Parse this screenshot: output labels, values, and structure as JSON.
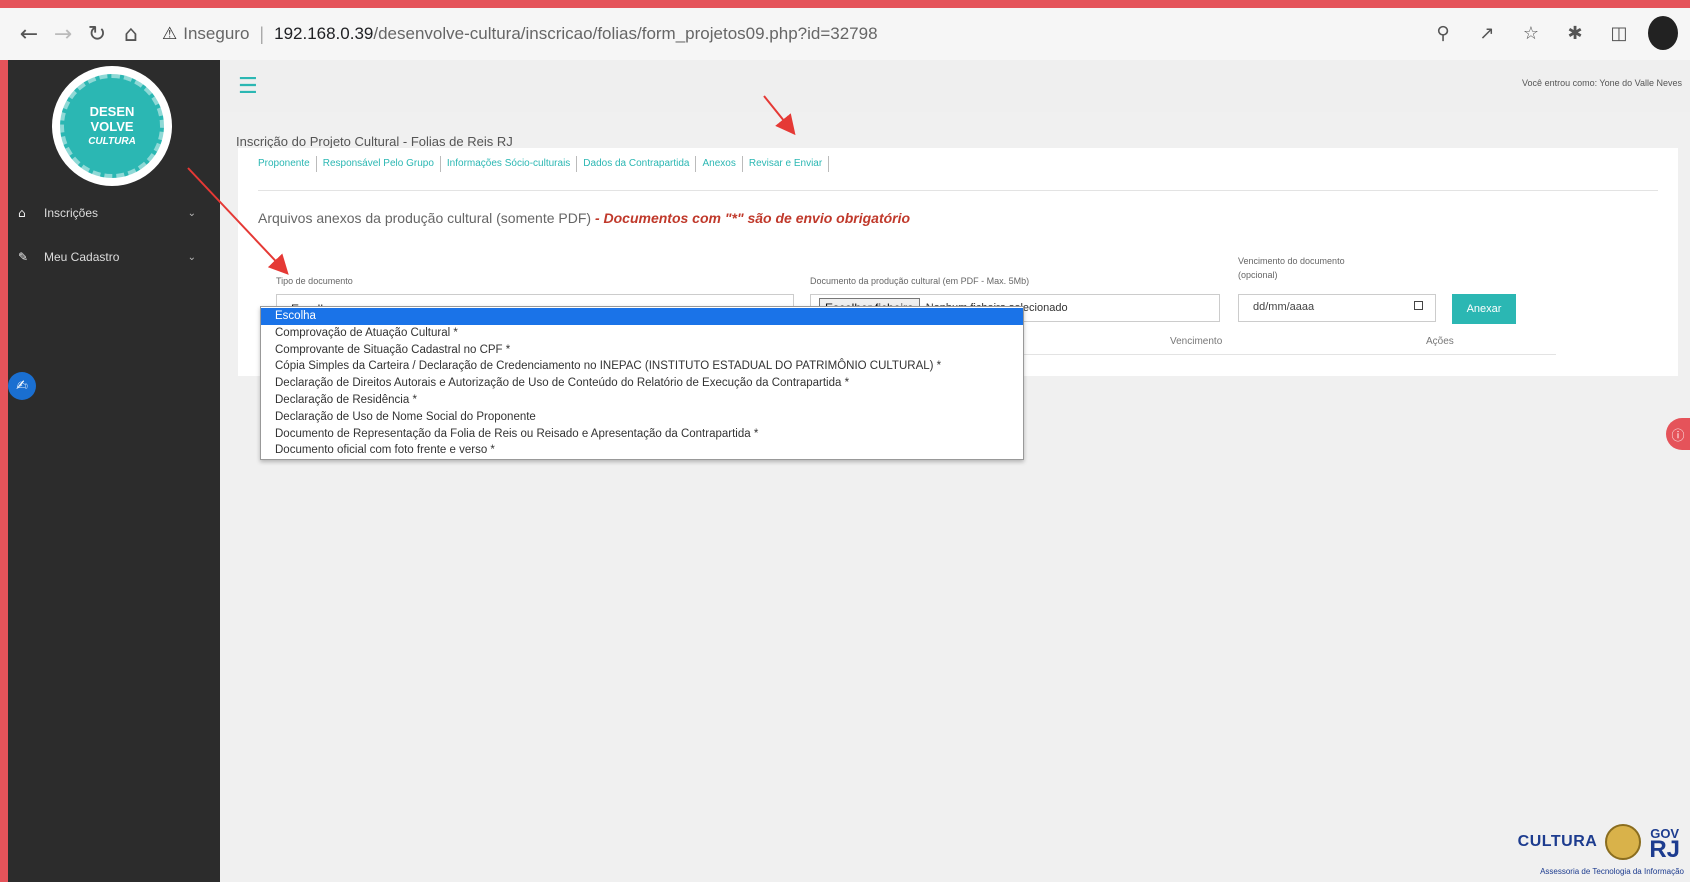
{
  "browser": {
    "insecure_label": "Inseguro",
    "url_host": "192.168.0.39",
    "url_path": "/desenvolve-cultura/inscricao/folias/form_projetos09.php?id=32798"
  },
  "sidebar": {
    "logo_line1": "DESEN",
    "logo_line2": "VOLVE",
    "logo_line3": "CULTURA",
    "items": [
      {
        "label": "Inscrições"
      },
      {
        "label": "Meu Cadastro"
      }
    ]
  },
  "header": {
    "user_info": "Você entrou como: Yone do Valle Neves"
  },
  "page": {
    "title": "Inscrição do Projeto Cultural - Folias de Reis RJ",
    "tabs": [
      {
        "label": "Proponente"
      },
      {
        "label": "Responsável Pelo Grupo"
      },
      {
        "label": "Informações Sócio-culturais"
      },
      {
        "label": "Dados da Contrapartida"
      },
      {
        "label": "Anexos"
      },
      {
        "label": "Revisar e Enviar"
      }
    ],
    "section_heading": "Arquivos anexos da produção cultural (somente PDF)",
    "section_required": " - Documentos com \"*\" são de envio obrigatório"
  },
  "form": {
    "doc_type_label": "Tipo de documento",
    "doc_type_value": "Escolha",
    "file_label": "Documento da produção cultural (em PDF - Max. 5Mb)",
    "file_button": "Escolher ficheiro",
    "file_status": "Nenhum ficheiro selecionado",
    "due_label_1": "Vencimento do documento",
    "due_label_2": "(opcional)",
    "date_placeholder": "dd/mm/aaaa",
    "attach_button": "Anexar",
    "col_vencimento": "Vencimento",
    "col_acoes": "Ações"
  },
  "dropdown": {
    "options": [
      "Escolha",
      "Comprovação de Atuação Cultural *",
      "Comprovante de Situação Cadastral no CPF *",
      "Cópia Simples da Carteira / Declaração de Credenciamento no INEPAC (INSTITUTO ESTADUAL DO PATRIMÔNIO CULTURAL) *",
      "Declaração de Direitos Autorais e Autorização de Uso de Conteúdo do Relatório de Execução da Contrapartida *",
      "Declaração de Residência *",
      "Declaração de Uso de Nome Social do Proponente",
      "Documento de Representação da Folia de Reis ou Reisado e Apresentação da Contrapartida *",
      "Documento oficial com foto frente e verso *"
    ]
  },
  "footer": {
    "brand": "CULTURA",
    "gov_line1": "GOV",
    "gov_line2": "RJ",
    "credit": "Assessoria de Tecnologia da Informação"
  },
  "colors": {
    "accent": "#2bb7b3",
    "frame": "#e5535a",
    "sidebar": "#2c2c2c",
    "annotation_arrow": "#e53935"
  }
}
